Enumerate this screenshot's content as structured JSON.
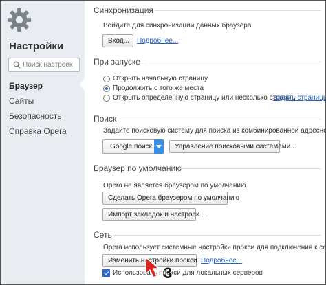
{
  "sidebar": {
    "title": "Настройки",
    "search_placeholder": "Поиск настроек",
    "items": [
      {
        "label": "Браузер",
        "active": true
      },
      {
        "label": "Сайты",
        "active": false
      },
      {
        "label": "Безопасность",
        "active": false
      },
      {
        "label": "Справка Opera",
        "active": false
      }
    ]
  },
  "sync": {
    "heading": "Синхронизация",
    "description": "Войдите для синхронизации данных браузера.",
    "login_button": "Вход...",
    "more_link": "Подробнее..."
  },
  "startup": {
    "heading": "При запуске",
    "options": [
      {
        "label": "Открыть начальную страницу",
        "selected": false
      },
      {
        "label": "Продолжить с того же места",
        "selected": true
      },
      {
        "label": "Открыть определенную страницу или несколько страниц",
        "selected": false
      }
    ],
    "set_pages_link": "Задать страницы"
  },
  "search": {
    "heading": "Поиск",
    "description": "Задайте поисковую систему для поиска из комбинированной адресной строки",
    "engine_selected": "Google поиск",
    "manage_button": "Управление поисковыми системами..."
  },
  "default_browser": {
    "heading": "Браузер по умолчанию",
    "description": "Opera не является браузером по умолчанию.",
    "make_default_button": "Сделать Opera браузером по умолчанию",
    "import_button": "Импорт закладок и настроек..."
  },
  "network": {
    "heading": "Сеть",
    "description": "Opera использует системные настройки прокси для подключения к сети.",
    "proxy_button": "Изменить настройки прокси...",
    "more_link": "Подробнее...",
    "local_proxy_label": "Использовать прокси для локальных серверов",
    "local_proxy_checked": true
  },
  "annotation": {
    "step_number": "3",
    "color": "#e0201b"
  },
  "colors": {
    "sidebar_bg": "#e9edf2",
    "link": "#2263c5",
    "accent": "#3a8ee6"
  }
}
